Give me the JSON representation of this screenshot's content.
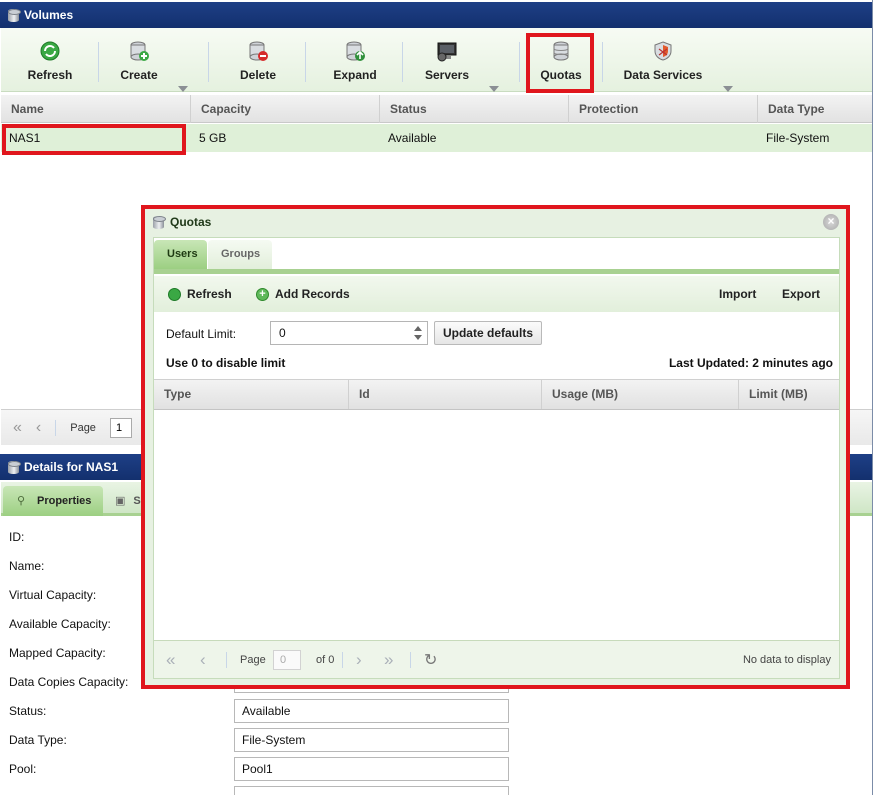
{
  "volumes_panel": {
    "title": "Volumes",
    "toolbar": {
      "refresh": "Refresh",
      "create": "Create",
      "delete": "Delete",
      "expand": "Expand",
      "servers": "Servers",
      "quotas": "Quotas",
      "data_services": "Data Services"
    },
    "columns": [
      "Name",
      "Capacity",
      "Status",
      "Protection",
      "Data Type"
    ],
    "rows": [
      {
        "name": "NAS1",
        "capacity": "5 GB",
        "status": "Available",
        "protection": "",
        "data_type": "File-System"
      }
    ],
    "pager": {
      "page_label": "Page",
      "page_value": "1"
    }
  },
  "details_panel": {
    "title": "Details for NAS1",
    "tabs": [
      "Properties",
      "S"
    ],
    "properties": [
      {
        "label": "ID:",
        "value": ""
      },
      {
        "label": "Name:",
        "value": ""
      },
      {
        "label": "Virtual Capacity:",
        "value": ""
      },
      {
        "label": "Available Capacity:",
        "value": ""
      },
      {
        "label": "Mapped Capacity:",
        "value": ""
      },
      {
        "label": "Data Copies Capacity:",
        "value": ""
      },
      {
        "label": "Status:",
        "value": "Available"
      },
      {
        "label": "Data Type:",
        "value": "File-System"
      },
      {
        "label": "Pool:",
        "value": "Pool1"
      }
    ]
  },
  "quotas_dialog": {
    "title": "Quotas",
    "close_symbol": "×",
    "tabs": {
      "users": "Users",
      "groups": "Groups"
    },
    "toolbar": {
      "refresh": "Refresh",
      "add_records": "Add Records",
      "import": "Import",
      "export": "Export"
    },
    "default_limit_label": "Default Limit:",
    "default_limit_value": "0",
    "update_defaults": "Update defaults",
    "hint": "Use 0 to disable limit",
    "last_updated": "Last Updated: 2 minutes ago",
    "columns": [
      "Type",
      "Id",
      "Usage (MB)",
      "Limit (MB)"
    ],
    "pager": {
      "page_label": "Page",
      "page_value": "0",
      "of_label": "of 0",
      "empty_text": "No data to display"
    }
  },
  "colors": {
    "header_blue": "#13306e",
    "accent_green": "#a8d191",
    "highlight_red": "#e0161d"
  }
}
